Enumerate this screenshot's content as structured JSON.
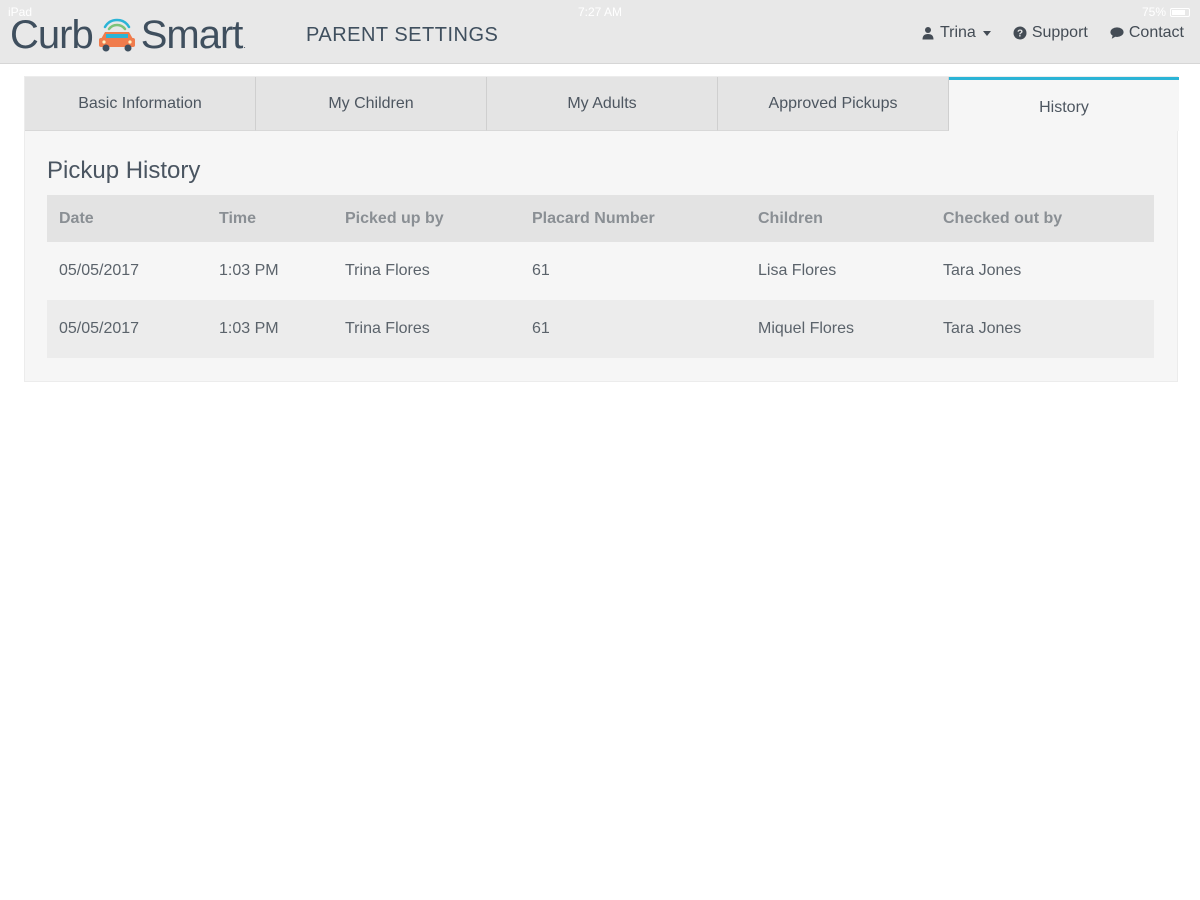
{
  "status_bar": {
    "carrier": "iPad",
    "time": "7:27 AM",
    "battery": "75%"
  },
  "header": {
    "logo_left": "Curb",
    "logo_right": "Smart",
    "logo_tm": ".",
    "section_title": "PARENT SETTINGS",
    "nav": {
      "user": "Trina",
      "support": "Support",
      "contact": "Contact"
    }
  },
  "tabs": [
    {
      "label": "Basic Information"
    },
    {
      "label": "My Children"
    },
    {
      "label": "My Adults"
    },
    {
      "label": "Approved Pickups"
    },
    {
      "label": "History"
    }
  ],
  "content": {
    "title": "Pickup History"
  },
  "table": {
    "columns": [
      "Date",
      "Time",
      "Picked up by",
      "Placard Number",
      "Children",
      "Checked out by"
    ],
    "rows": [
      [
        "05/05/2017",
        "1:03 PM",
        "Trina Flores",
        "61",
        "Lisa Flores",
        "Tara Jones"
      ],
      [
        "05/05/2017",
        "1:03 PM",
        "Trina Flores",
        "61",
        "Miquel Flores",
        "Tara Jones"
      ]
    ]
  },
  "colors": {
    "accent": "#2bb4d6",
    "header_bg": "#e8e8e8",
    "logo_text": "#3f4f5e",
    "car_orange": "#f07c4c",
    "car_blue": "#2bb4d6",
    "car_green": "#7dc37a"
  },
  "icons": {
    "user": "user-icon",
    "support": "question-circle-icon",
    "contact": "speech-bubble-icon",
    "logo": "car-icon"
  }
}
